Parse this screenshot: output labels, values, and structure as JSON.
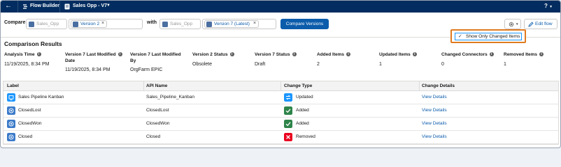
{
  "topbar": {
    "app_name": "Flow Builder",
    "flow_name": "Sales Opp - V7",
    "help": "?"
  },
  "compare": {
    "compare_label": "Compare",
    "with_label": "with",
    "left_flow_placeholder": "Sales_Opp",
    "left_version": "Version 2",
    "right_flow_placeholder": "Sales_Opp",
    "right_version": "Version 7 (Latest)",
    "compare_button": "Compare Versions",
    "edit_button": "Edit flow"
  },
  "menu": {
    "show_only_changed": "Show Only Changed Items"
  },
  "results": {
    "title": "Comparison Results",
    "summary": [
      {
        "header_lines": [
          "Analysis Time"
        ],
        "value": "11/19/2025, 8:34 PM"
      },
      {
        "header_lines": [
          "Version 7 Last Modified",
          "Date"
        ],
        "value": "11/19/2025, 8:34 PM"
      },
      {
        "header_lines": [
          "Version 7 Last Modified",
          "By"
        ],
        "value": "OrgFarm EPIC"
      },
      {
        "header_lines": [
          "Version 2 Status"
        ],
        "value": "Obsolete"
      },
      {
        "header_lines": [
          "Version 7 Status"
        ],
        "value": "Draft"
      },
      {
        "header_lines": [
          "Added Items"
        ],
        "value": "2"
      },
      {
        "header_lines": [
          "Updated Items"
        ],
        "value": "1"
      },
      {
        "header_lines": [
          "Changed Connectors"
        ],
        "value": "0"
      },
      {
        "header_lines": [
          "Removed Items"
        ],
        "value": "1"
      }
    ]
  },
  "table": {
    "headers": [
      "Label",
      "API Name",
      "Change Type",
      "Change Details"
    ],
    "rows": [
      {
        "label": "Sales Pipeline Kanban",
        "api_name": "Sales_Pipeline_Kanban",
        "change_type": "Updated",
        "details": "View Details",
        "row_icon": "screen-icon",
        "change_icon": "updated-icon"
      },
      {
        "label": "ClosedLost",
        "api_name": "ClosedLost",
        "change_type": "Added",
        "details": "View Details",
        "row_icon": "outcome-icon",
        "change_icon": "added-check-icon"
      },
      {
        "label": "ClosedWon",
        "api_name": "ClosedWon",
        "change_type": "Added",
        "details": "View Details",
        "row_icon": "outcome-icon",
        "change_icon": "added-check-icon"
      },
      {
        "label": "Closed",
        "api_name": "Closed",
        "change_type": "Removed",
        "details": "View Details",
        "row_icon": "outcome-icon",
        "change_icon": "removed-x-icon"
      }
    ]
  },
  "colors": {
    "nav_bg": "#032d60",
    "brand_blue": "#0b5cab",
    "added_green": "#2e844a",
    "removed_red": "#ea001e",
    "updated_blue": "#1b96ff",
    "highlight_orange": "#e07b21"
  }
}
